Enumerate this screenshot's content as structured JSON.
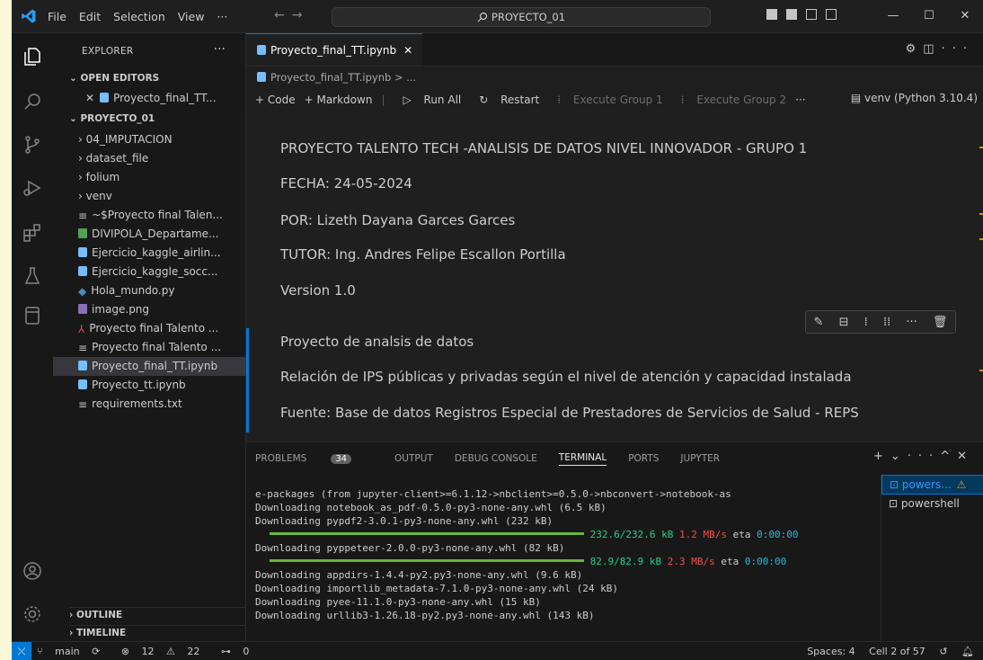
{
  "menu": [
    "File",
    "Edit",
    "Selection",
    "View",
    "···"
  ],
  "search": {
    "text": "PROYECTO_01"
  },
  "window_controls": [
    "—",
    "☐",
    "✕"
  ],
  "explorer": {
    "title": "EXPLORER",
    "more": "···",
    "open_editors_label": "OPEN EDITORS",
    "open_editor_item": "Proyecto_final_TT...",
    "project_label": "PROYECTO_01",
    "items": [
      {
        "label": "04_IMPUTACION",
        "kind": "folder"
      },
      {
        "label": "dataset_file",
        "kind": "folder"
      },
      {
        "label": "folium",
        "kind": "folder"
      },
      {
        "label": "venv",
        "kind": "folder"
      },
      {
        "label": "~$Proyecto final Talen...",
        "kind": "txt"
      },
      {
        "label": "DIVIPOLA_Departame...",
        "kind": "csv"
      },
      {
        "label": "Ejercicio_kaggle_airlin...",
        "kind": "nb"
      },
      {
        "label": "Ejercicio_kaggle_socc...",
        "kind": "nb"
      },
      {
        "label": "Hola_mundo.py",
        "kind": "py"
      },
      {
        "label": "image.png",
        "kind": "png"
      },
      {
        "label": "Proyecto final Talento ...",
        "kind": "pdf"
      },
      {
        "label": "Proyecto final Talento ...",
        "kind": "txt"
      },
      {
        "label": "Proyecto_final_TT.ipynb",
        "kind": "nb"
      },
      {
        "label": "Proyecto_tt.ipynb",
        "kind": "nb"
      },
      {
        "label": "requirements.txt",
        "kind": "txt"
      }
    ],
    "outline_label": "OUTLINE",
    "timeline_label": "TIMELINE"
  },
  "editor": {
    "tab_label": "Proyecto_final_TT.ipynb",
    "breadcrumb": "Proyecto_final_TT.ipynb > ...",
    "toolbar": {
      "code": "+ Code",
      "markdown": "+ Markdown",
      "run_all": "Run All",
      "restart": "Restart",
      "exec1": "Execute Group 1",
      "exec2": "Execute Group 2",
      "more": "···"
    },
    "kernel": "venv (Python 3.10.4)",
    "cell_lines": [
      "PROYECTO TALENTO TECH -ANALISIS DE DATOS NIVEL INNOVADOR - GRUPO 1",
      "FECHA: 24-05-2024",
      "POR: Lizeth Dayana Garces Garces",
      "TUTOR: Ing. Andres Felipe Escallon Portilla",
      "Version 1.0",
      "Proyecto de analsis de datos",
      "Relación de IPS públicas y privadas según el nivel de atención y capacidad instalada",
      "Fuente: Base de datos Registros Especial de Prestadores de Servicios de Salud - REPS"
    ]
  },
  "panel": {
    "tabs": [
      "PROBLEMS",
      "OUTPUT",
      "DEBUG CONSOLE",
      "TERMINAL",
      "PORTS",
      "JUPYTER"
    ],
    "problems_count": "34",
    "terminal_lines": [
      "e-packages (from jupyter-client>=6.1.12->nbclient>=0.5.0->nbconvert->notebook-as",
      "Downloading notebook_as_pdf-0.5.0-py3-none-any.whl (6.5 kB)",
      "Downloading pypdf2-3.0.1-py3-none-any.whl (232 kB)",
      "Downloading pyppeteer-2.0.0-py3-none-any.whl (82 kB)",
      "Downloading appdirs-1.4.4-py2.py3-none-any.whl (9.6 kB)",
      "Downloading importlib_metadata-7.1.0-py3-none-any.whl (24 kB)",
      "Downloading pyee-11.1.0-py3-none-any.whl (15 kB)",
      "Downloading urllib3-1.26.18-py2.py3-none-any.whl (143 kB)"
    ],
    "progress1": {
      "size": "232.6/232.6 kB",
      "speed": "1.2 MB/s",
      "eta_label": "eta",
      "eta": "0:00:00"
    },
    "progress2": {
      "size": "82.9/82.9 kB",
      "speed": "2.3 MB/s",
      "eta_label": "eta",
      "eta": "0:00:00"
    },
    "terminals": [
      "powers...",
      "powershell"
    ]
  },
  "status": {
    "branch": "main",
    "errors": "12",
    "warnings": "22",
    "ports": "0",
    "spaces": "Spaces: 4",
    "cell": "Cell 2 of 57"
  }
}
